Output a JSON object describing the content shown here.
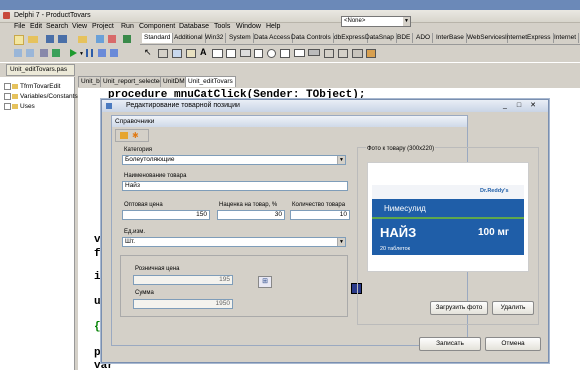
{
  "app": {
    "title": "Delphi 7 - ProductTovars",
    "menu": [
      "File",
      "Edit",
      "Search",
      "View",
      "Project",
      "Run",
      "Component",
      "Database",
      "Tools",
      "Window",
      "Help"
    ],
    "component_combo": "<None>",
    "palette_tabs": [
      "Standard",
      "Additional",
      "Win32",
      "System",
      "Data Access",
      "Data Controls",
      "dbExpress",
      "DataSnap",
      "BDE",
      "ADO",
      "InterBase",
      "WebServices",
      "InternetExpress",
      "Internet"
    ],
    "unit_file_tab": "Unit_editTovars.pas",
    "tree": [
      "TfrmTovarEdit",
      "Variables/Constants",
      "Uses"
    ],
    "editor_tabs": [
      "Unit_b",
      "Unit_report_selected",
      "UnitDM",
      "Unit_editTovars"
    ],
    "code_lines": [
      "procedure mnuCatClick(Sender: TObject);",
      "p",
      "p",
      "e",
      "var",
      "  frm",
      "imp",
      "use",
      "{$R",
      "pro",
      "var"
    ]
  },
  "dialog": {
    "title": "Редактирование товарной позиции",
    "subwindow_title": "Справочники",
    "fields": {
      "category_label": "Категория",
      "category_value": "Болеутоляющие",
      "name_label": "Наименование товара",
      "name_value": "Найз",
      "wholesale_label": "Оптовая цена",
      "wholesale_value": "150",
      "markup_label": "Наценка на товар, %",
      "markup_value": "30",
      "qty_label": "Количество товара",
      "qty_value": "10",
      "unit_label": "Ед.изм.",
      "unit_value": "Шт.",
      "retail_label": "Розничная цена",
      "retail_value": "195",
      "sum_label": "Сумма",
      "sum_value": "1950"
    },
    "photo": {
      "group_label": "Фото к товару (300х220)",
      "brand": "Dr.Reddy's",
      "generic": "Нимесулид",
      "product": "НАЙЗ",
      "dose": "100 мг",
      "tablets": "20 таблеток",
      "load_button": "Загрузить фото",
      "delete_button": "Удалить"
    },
    "save_button": "Записать",
    "cancel_button": "Отмена"
  },
  "colors": {
    "accent": "#6b89b8",
    "photo_band": "#1f5ea8",
    "photo_green": "#5fa84b"
  }
}
